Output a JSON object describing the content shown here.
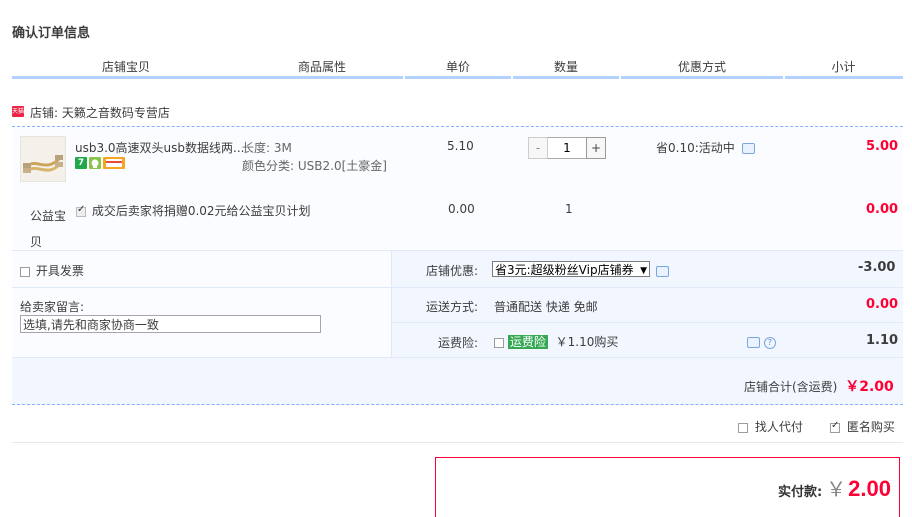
{
  "page_title": "确认订单信息",
  "columns": [
    "店铺宝贝",
    "商品属性",
    "单价",
    "数量",
    "优惠方式",
    "小计"
  ],
  "store": {
    "badge": "天猫",
    "label": "店铺: 天籁之音数码专营店"
  },
  "item": {
    "name": "usb3.0高速双头usb数据线两...",
    "attributes": [
      "长度: 3M",
      "颜色分类: USB2.0[土豪金]"
    ],
    "badge_icons": [
      "7-day-return-icon",
      "guarantee-icon",
      "credit-card-icon"
    ],
    "badge_7": "7",
    "price": "5.10",
    "quantity": "1",
    "qty_minus": "-",
    "qty_plus": "+",
    "discount": "省0.10:活动中",
    "subtotal": "5.00"
  },
  "charity": {
    "label": "公益宝贝",
    "text": "成交后卖家将捐赠0.02元给公益宝贝计划",
    "price": "0.00",
    "quantity": "1",
    "subtotal": "0.00"
  },
  "invoice": {
    "label": "开具发票"
  },
  "message": {
    "label": "给卖家留言:",
    "placeholder": "选填,请先和商家协商一致"
  },
  "store_coupon": {
    "label": "店铺优惠:",
    "selected": "省3元:超级粉丝Vip店铺券",
    "amount": "-3.00"
  },
  "shipping": {
    "label": "运送方式:",
    "value": "普通配送 快递 免邮",
    "amount": "0.00"
  },
  "insurance": {
    "label": "运费险:",
    "tag": "运费险",
    "price": "￥1.10购买",
    "amount": "1.10"
  },
  "store_total": {
    "label": "店铺合计(含运费)",
    "amount": "￥2.00"
  },
  "options": {
    "proxy_pay": "找人代付",
    "anonymous": "匿名购买"
  },
  "payment": {
    "label": "实付款:",
    "currency": "￥",
    "amount": "2.00"
  },
  "colors": {
    "accent_blue": "#b2d1ff",
    "price_red": "#ff0033",
    "pay_border": "#ff0036"
  }
}
